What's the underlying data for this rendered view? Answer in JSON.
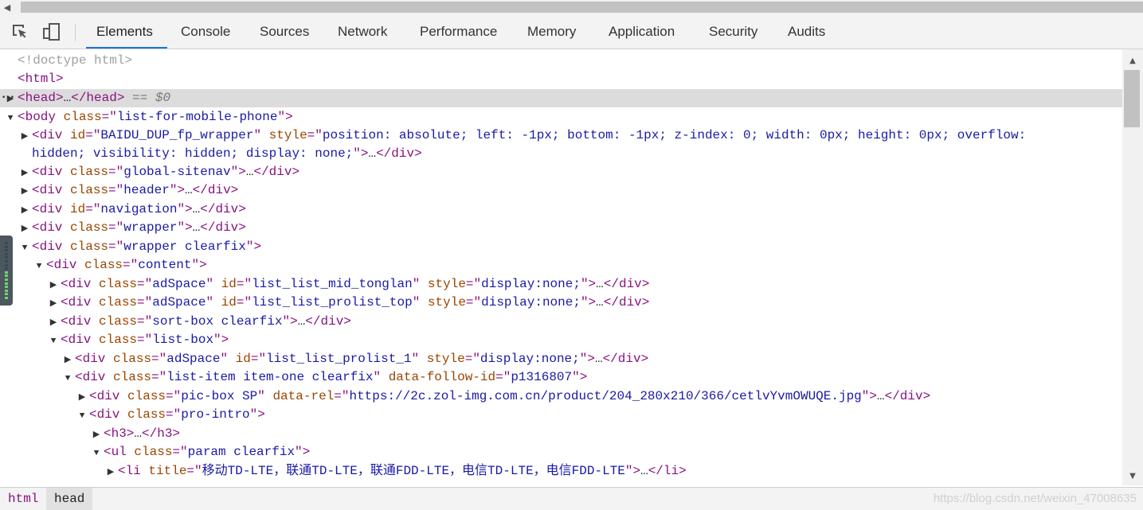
{
  "tabs": [
    {
      "label": "Elements",
      "active": true
    },
    {
      "label": "Console"
    },
    {
      "label": "Sources"
    },
    {
      "label": "Network"
    },
    {
      "label": "Performance"
    },
    {
      "label": "Memory"
    },
    {
      "label": "Application"
    },
    {
      "label": "Security"
    },
    {
      "label": "Audits"
    }
  ],
  "dom_lines": [
    {
      "arrow": "",
      "selected": false,
      "parts": [
        {
          "c": "gray",
          "t": "<!doctype html>"
        }
      ]
    },
    {
      "arrow": "",
      "selected": false,
      "parts": [
        {
          "c": "tag",
          "t": "<html>"
        }
      ]
    },
    {
      "arrow": "▶",
      "selected": true,
      "parts": [
        {
          "c": "tag",
          "t": "<head>"
        },
        {
          "c": "txt",
          "t": "…"
        },
        {
          "c": "tag",
          "t": "</head>"
        },
        {
          "c": "txt",
          "t": " "
        },
        {
          "c": "dollar",
          "t": "== $0"
        }
      ]
    },
    {
      "arrow": "▼",
      "selected": false,
      "parts": [
        {
          "c": "tag",
          "t": "<body "
        },
        {
          "c": "an",
          "t": "class"
        },
        {
          "c": "tag",
          "t": "=\""
        },
        {
          "c": "av",
          "t": "list-for-mobile-phone"
        },
        {
          "c": "tag",
          "t": "\">"
        }
      ]
    },
    {
      "arrow": "▶",
      "selected": false,
      "parts": [
        {
          "c": "tag",
          "t": "<div "
        },
        {
          "c": "an",
          "t": "id"
        },
        {
          "c": "tag",
          "t": "=\""
        },
        {
          "c": "av",
          "t": "BAIDU_DUP_fp_wrapper"
        },
        {
          "c": "tag",
          "t": "\" "
        },
        {
          "c": "an",
          "t": "style"
        },
        {
          "c": "tag",
          "t": "=\""
        },
        {
          "c": "av",
          "t": "position: absolute; left: -1px; bottom: -1px; z-index: 0; width: 0px; height: 0px; overflow:"
        }
      ]
    },
    {
      "arrow": "",
      "selected": false,
      "parts": [
        {
          "c": "av",
          "t": "hidden; visibility: hidden; display: none;"
        },
        {
          "c": "tag",
          "t": "\">"
        },
        {
          "c": "txt",
          "t": "…"
        },
        {
          "c": "tag",
          "t": "</div>"
        }
      ]
    },
    {
      "arrow": "▶",
      "selected": false,
      "parts": [
        {
          "c": "tag",
          "t": "<div "
        },
        {
          "c": "an",
          "t": "class"
        },
        {
          "c": "tag",
          "t": "=\""
        },
        {
          "c": "av",
          "t": "global-sitenav"
        },
        {
          "c": "tag",
          "t": "\">"
        },
        {
          "c": "txt",
          "t": "…"
        },
        {
          "c": "tag",
          "t": "</div>"
        }
      ]
    },
    {
      "arrow": "▶",
      "selected": false,
      "parts": [
        {
          "c": "tag",
          "t": "<div "
        },
        {
          "c": "an",
          "t": "class"
        },
        {
          "c": "tag",
          "t": "=\""
        },
        {
          "c": "av",
          "t": "header"
        },
        {
          "c": "tag",
          "t": "\">"
        },
        {
          "c": "txt",
          "t": "…"
        },
        {
          "c": "tag",
          "t": "</div>"
        }
      ]
    },
    {
      "arrow": "▶",
      "selected": false,
      "parts": [
        {
          "c": "tag",
          "t": "<div "
        },
        {
          "c": "an",
          "t": "id"
        },
        {
          "c": "tag",
          "t": "=\""
        },
        {
          "c": "av",
          "t": "navigation"
        },
        {
          "c": "tag",
          "t": "\">"
        },
        {
          "c": "txt",
          "t": "…"
        },
        {
          "c": "tag",
          "t": "</div>"
        }
      ]
    },
    {
      "arrow": "▶",
      "selected": false,
      "parts": [
        {
          "c": "tag",
          "t": "<div "
        },
        {
          "c": "an",
          "t": "class"
        },
        {
          "c": "tag",
          "t": "=\""
        },
        {
          "c": "av",
          "t": "wrapper"
        },
        {
          "c": "tag",
          "t": "\">"
        },
        {
          "c": "txt",
          "t": "…"
        },
        {
          "c": "tag",
          "t": "</div>"
        }
      ]
    },
    {
      "arrow": "▼",
      "selected": false,
      "parts": [
        {
          "c": "tag",
          "t": "<div "
        },
        {
          "c": "an",
          "t": "class"
        },
        {
          "c": "tag",
          "t": "=\""
        },
        {
          "c": "av",
          "t": "wrapper clearfix"
        },
        {
          "c": "tag",
          "t": "\">"
        }
      ]
    },
    {
      "arrow": "▼",
      "selected": false,
      "parts": [
        {
          "c": "tag",
          "t": "<div "
        },
        {
          "c": "an",
          "t": "class"
        },
        {
          "c": "tag",
          "t": "=\""
        },
        {
          "c": "av",
          "t": "content"
        },
        {
          "c": "tag",
          "t": "\">"
        }
      ]
    },
    {
      "arrow": "▶",
      "selected": false,
      "parts": [
        {
          "c": "tag",
          "t": "<div "
        },
        {
          "c": "an",
          "t": "class"
        },
        {
          "c": "tag",
          "t": "=\""
        },
        {
          "c": "av",
          "t": "adSpace"
        },
        {
          "c": "tag",
          "t": "\" "
        },
        {
          "c": "an",
          "t": "id"
        },
        {
          "c": "tag",
          "t": "=\""
        },
        {
          "c": "av",
          "t": "list_list_mid_tonglan"
        },
        {
          "c": "tag",
          "t": "\" "
        },
        {
          "c": "an",
          "t": "style"
        },
        {
          "c": "tag",
          "t": "=\""
        },
        {
          "c": "av",
          "t": "display:none;"
        },
        {
          "c": "tag",
          "t": "\">"
        },
        {
          "c": "txt",
          "t": "…"
        },
        {
          "c": "tag",
          "t": "</div>"
        }
      ]
    },
    {
      "arrow": "▶",
      "selected": false,
      "parts": [
        {
          "c": "tag",
          "t": "<div "
        },
        {
          "c": "an",
          "t": "class"
        },
        {
          "c": "tag",
          "t": "=\""
        },
        {
          "c": "av",
          "t": "adSpace"
        },
        {
          "c": "tag",
          "t": "\" "
        },
        {
          "c": "an",
          "t": "id"
        },
        {
          "c": "tag",
          "t": "=\""
        },
        {
          "c": "av",
          "t": "list_list_prolist_top"
        },
        {
          "c": "tag",
          "t": "\" "
        },
        {
          "c": "an",
          "t": "style"
        },
        {
          "c": "tag",
          "t": "=\""
        },
        {
          "c": "av",
          "t": "display:none;"
        },
        {
          "c": "tag",
          "t": "\">"
        },
        {
          "c": "txt",
          "t": "…"
        },
        {
          "c": "tag",
          "t": "</div>"
        }
      ]
    },
    {
      "arrow": "▶",
      "selected": false,
      "parts": [
        {
          "c": "tag",
          "t": "<div "
        },
        {
          "c": "an",
          "t": "class"
        },
        {
          "c": "tag",
          "t": "=\""
        },
        {
          "c": "av",
          "t": "sort-box clearfix"
        },
        {
          "c": "tag",
          "t": "\">"
        },
        {
          "c": "txt",
          "t": "…"
        },
        {
          "c": "tag",
          "t": "</div>"
        }
      ]
    },
    {
      "arrow": "▼",
      "selected": false,
      "parts": [
        {
          "c": "tag",
          "t": "<div "
        },
        {
          "c": "an",
          "t": "class"
        },
        {
          "c": "tag",
          "t": "=\""
        },
        {
          "c": "av",
          "t": "list-box"
        },
        {
          "c": "tag",
          "t": "\">"
        }
      ]
    },
    {
      "arrow": "▶",
      "selected": false,
      "parts": [
        {
          "c": "tag",
          "t": "<div "
        },
        {
          "c": "an",
          "t": "class"
        },
        {
          "c": "tag",
          "t": "=\""
        },
        {
          "c": "av",
          "t": "adSpace"
        },
        {
          "c": "tag",
          "t": "\" "
        },
        {
          "c": "an",
          "t": "id"
        },
        {
          "c": "tag",
          "t": "=\""
        },
        {
          "c": "av",
          "t": "list_list_prolist_1"
        },
        {
          "c": "tag",
          "t": "\" "
        },
        {
          "c": "an",
          "t": "style"
        },
        {
          "c": "tag",
          "t": "=\""
        },
        {
          "c": "av",
          "t": "display:none;"
        },
        {
          "c": "tag",
          "t": "\">"
        },
        {
          "c": "txt",
          "t": "…"
        },
        {
          "c": "tag",
          "t": "</div>"
        }
      ]
    },
    {
      "arrow": "▼",
      "selected": false,
      "parts": [
        {
          "c": "tag",
          "t": "<div "
        },
        {
          "c": "an",
          "t": "class"
        },
        {
          "c": "tag",
          "t": "=\""
        },
        {
          "c": "av",
          "t": "list-item item-one clearfix"
        },
        {
          "c": "tag",
          "t": "\" "
        },
        {
          "c": "an",
          "t": "data-follow-id"
        },
        {
          "c": "tag",
          "t": "=\""
        },
        {
          "c": "av",
          "t": "p1316807"
        },
        {
          "c": "tag",
          "t": "\">"
        }
      ]
    },
    {
      "arrow": "▶",
      "selected": false,
      "parts": [
        {
          "c": "tag",
          "t": "<div "
        },
        {
          "c": "an",
          "t": "class"
        },
        {
          "c": "tag",
          "t": "=\""
        },
        {
          "c": "av",
          "t": "pic-box SP"
        },
        {
          "c": "tag",
          "t": "\" "
        },
        {
          "c": "an",
          "t": "data-rel"
        },
        {
          "c": "tag",
          "t": "=\""
        },
        {
          "c": "av",
          "t": "https://2c.zol-img.com.cn/product/204_280x210/366/cetlvYvmOWUQE.jpg"
        },
        {
          "c": "tag",
          "t": "\">"
        },
        {
          "c": "txt",
          "t": "…"
        },
        {
          "c": "tag",
          "t": "</div>"
        }
      ]
    },
    {
      "arrow": "▼",
      "selected": false,
      "parts": [
        {
          "c": "tag",
          "t": "<div "
        },
        {
          "c": "an",
          "t": "class"
        },
        {
          "c": "tag",
          "t": "=\""
        },
        {
          "c": "av",
          "t": "pro-intro"
        },
        {
          "c": "tag",
          "t": "\">"
        }
      ]
    },
    {
      "arrow": "▶",
      "selected": false,
      "parts": [
        {
          "c": "tag",
          "t": "<h3>"
        },
        {
          "c": "txt",
          "t": "…"
        },
        {
          "c": "tag",
          "t": "</h3>"
        }
      ]
    },
    {
      "arrow": "▼",
      "selected": false,
      "parts": [
        {
          "c": "tag",
          "t": "<ul "
        },
        {
          "c": "an",
          "t": "class"
        },
        {
          "c": "tag",
          "t": "=\""
        },
        {
          "c": "av",
          "t": "param clearfix"
        },
        {
          "c": "tag",
          "t": "\">"
        }
      ]
    },
    {
      "arrow": "▶",
      "selected": false,
      "parts": [
        {
          "c": "tag",
          "t": "<li "
        },
        {
          "c": "an",
          "t": "title"
        },
        {
          "c": "tag",
          "t": "=\""
        },
        {
          "c": "av",
          "t": "移动TD-LTE，联通TD-LTE，联通FDD-LTE，电信TD-LTE，电信FDD-LTE"
        },
        {
          "c": "tag",
          "t": "\">"
        },
        {
          "c": "txt",
          "t": "…"
        },
        {
          "c": "tag",
          "t": "</li>"
        }
      ]
    }
  ],
  "selected_suffix": "== $0",
  "breadcrumbs": [
    {
      "label": "html"
    },
    {
      "label": "head",
      "active": true
    }
  ],
  "watermark": "https://blog.csdn.net/weixin_47008635"
}
